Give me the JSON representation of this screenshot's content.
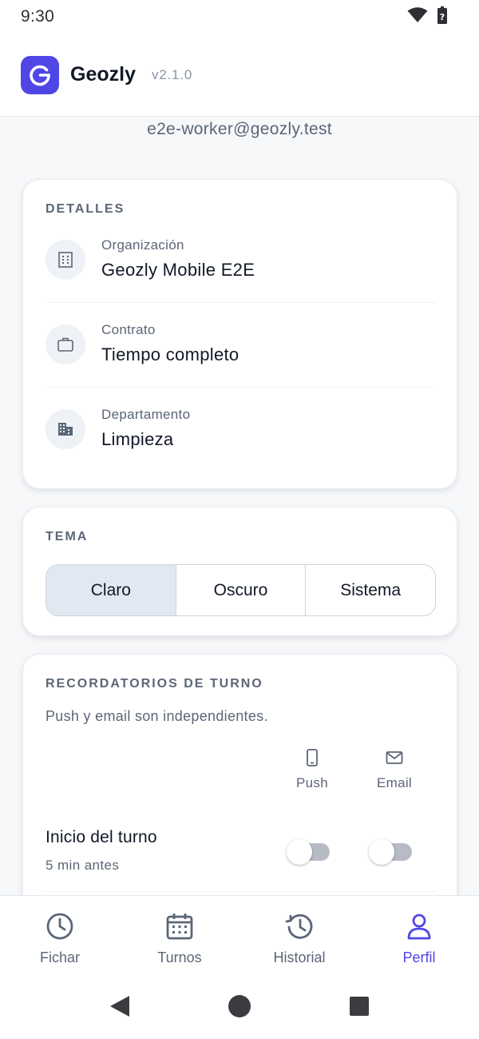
{
  "status_bar": {
    "time": "9:30"
  },
  "header": {
    "app_name": "Geozly",
    "version": "v2.1.0"
  },
  "profile": {
    "email": "e2e-worker@geozly.test"
  },
  "details": {
    "title": "DETALLES",
    "items": [
      {
        "label": "Organización",
        "value": "Geozly Mobile E2E",
        "icon": "building-icon"
      },
      {
        "label": "Contrato",
        "value": "Tiempo completo",
        "icon": "briefcase-icon"
      },
      {
        "label": "Departamento",
        "value": "Limpieza",
        "icon": "department-icon"
      }
    ]
  },
  "theme": {
    "title": "TEMA",
    "options": [
      "Claro",
      "Oscuro",
      "Sistema"
    ],
    "selected": "Claro"
  },
  "reminders": {
    "title": "RECORDATORIOS DE TURNO",
    "subtitle": "Push y email son independientes.",
    "channels": [
      {
        "label": "Push",
        "icon": "phone-icon"
      },
      {
        "label": "Email",
        "icon": "mail-icon"
      }
    ],
    "items": [
      {
        "title": "Inicio del turno",
        "subtitle": "5 min antes",
        "push": false,
        "email": false
      }
    ]
  },
  "bottom_nav": {
    "items": [
      {
        "label": "Fichar",
        "icon": "clock-icon"
      },
      {
        "label": "Turnos",
        "icon": "calendar-icon"
      },
      {
        "label": "Historial",
        "icon": "history-icon"
      },
      {
        "label": "Perfil",
        "icon": "person-icon"
      }
    ],
    "active": "Perfil",
    "active_color": "#4f46e5"
  },
  "colors": {
    "brand": "#4f46e5",
    "toggle_off": "#b7bcc4"
  }
}
